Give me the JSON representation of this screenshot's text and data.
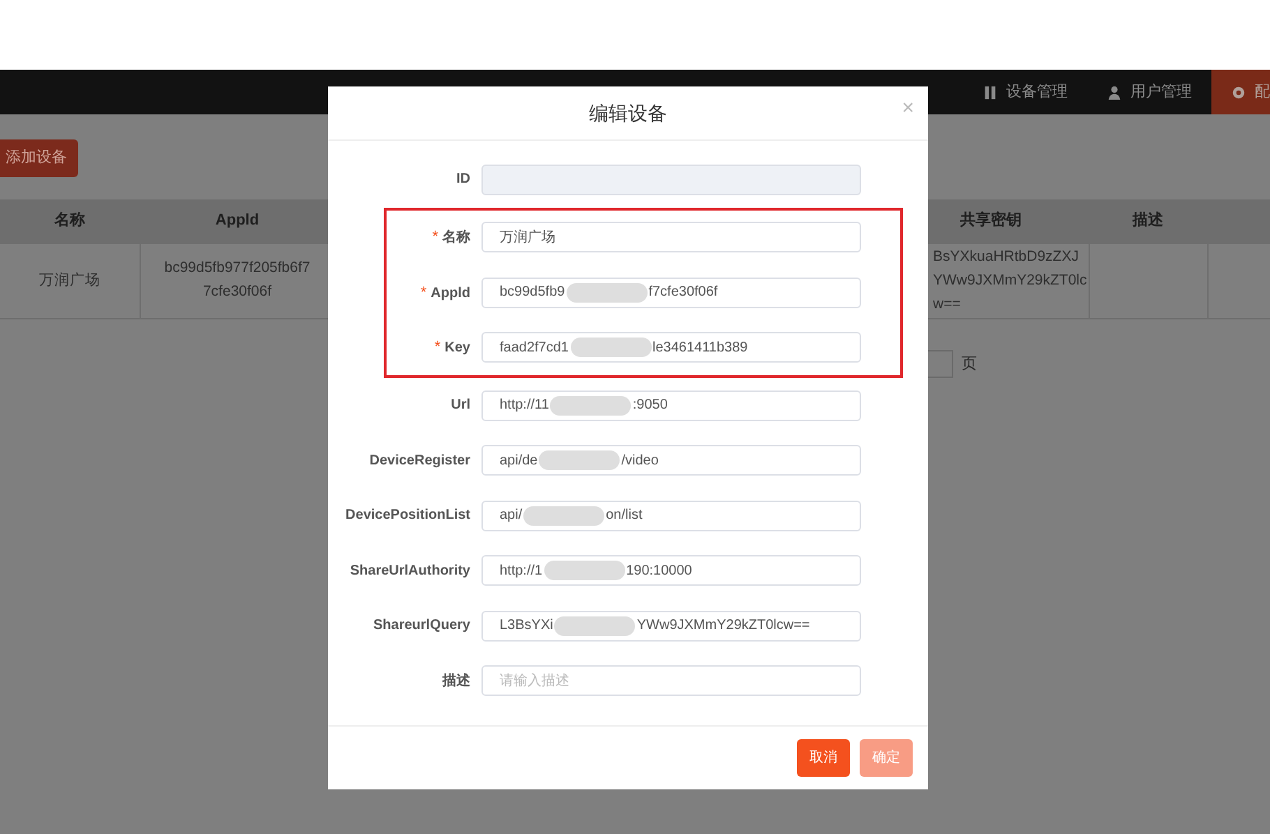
{
  "nav": [
    {
      "label": "设备管理",
      "selected": false
    },
    {
      "label": "用户管理",
      "selected": false
    },
    {
      "label": "配",
      "selected": true
    }
  ],
  "add_button": "添加设备",
  "table": {
    "columns": [
      "名称",
      "Appld",
      "",
      "共享密钥",
      "描述",
      ""
    ],
    "rows": [
      [
        [
          "万润广场"
        ],
        [
          "bc99d5fb977f205fb6f7",
          "7cfe30f06f"
        ],
        [],
        [
          "BsYXkuaHRtbD9zZXJ",
          "YWw9JXMmY29kZT0lc",
          "w=="
        ],
        [],
        []
      ]
    ]
  },
  "pagination": {
    "suffix": "页"
  },
  "dialog": {
    "title": "编辑设备",
    "close": "×",
    "sections": [
      {
        "highlighted": false,
        "fields": [
          {
            "label": "ID",
            "disabled": true,
            "redacted": false
          }
        ]
      },
      {
        "highlighted": true,
        "fields": [
          {
            "required_mark": "*",
            "label": "名称",
            "disabled": false,
            "value": "万润广场",
            "redacted": false
          },
          {
            "required_mark": "*",
            "label": "Appld",
            "disabled": false,
            "value": "bc99d5fb9",
            "value_end": "f7cfe30f06f",
            "redacted": true
          },
          {
            "required_mark": "*",
            "label": "Key",
            "disabled": false,
            "value": "faad2f7cd1",
            "value_end": "le3461411b389",
            "redacted": true
          }
        ]
      },
      {
        "highlighted": false,
        "fields": [
          {
            "label": "Url",
            "disabled": false,
            "value": "http://11",
            "value_end": ":9050",
            "redacted": true
          },
          {
            "label": "DeviceRegister",
            "disabled": false,
            "value": "api/de",
            "value_end": "/video",
            "redacted": true
          },
          {
            "label": "DevicePositionList",
            "disabled": false,
            "value": "api/",
            "value_end": "on/list",
            "redacted": true
          },
          {
            "label": "ShareUrlAuthority",
            "disabled": false,
            "value": "http://1",
            "value_end": "190:10000",
            "redacted": true
          },
          {
            "label": "ShareurlQuery",
            "disabled": false,
            "value": "L3BsYXi",
            "value_end": "YWw9JXMmY29kZT0lcw==",
            "redacted": true
          },
          {
            "label": "描述",
            "disabled": false,
            "placeholder": "请输入描述",
            "redacted": false
          }
        ]
      }
    ],
    "buttons": [
      {
        "label": "取消",
        "kind": "primary"
      },
      {
        "label": "确定",
        "kind": "confirm"
      }
    ]
  }
}
